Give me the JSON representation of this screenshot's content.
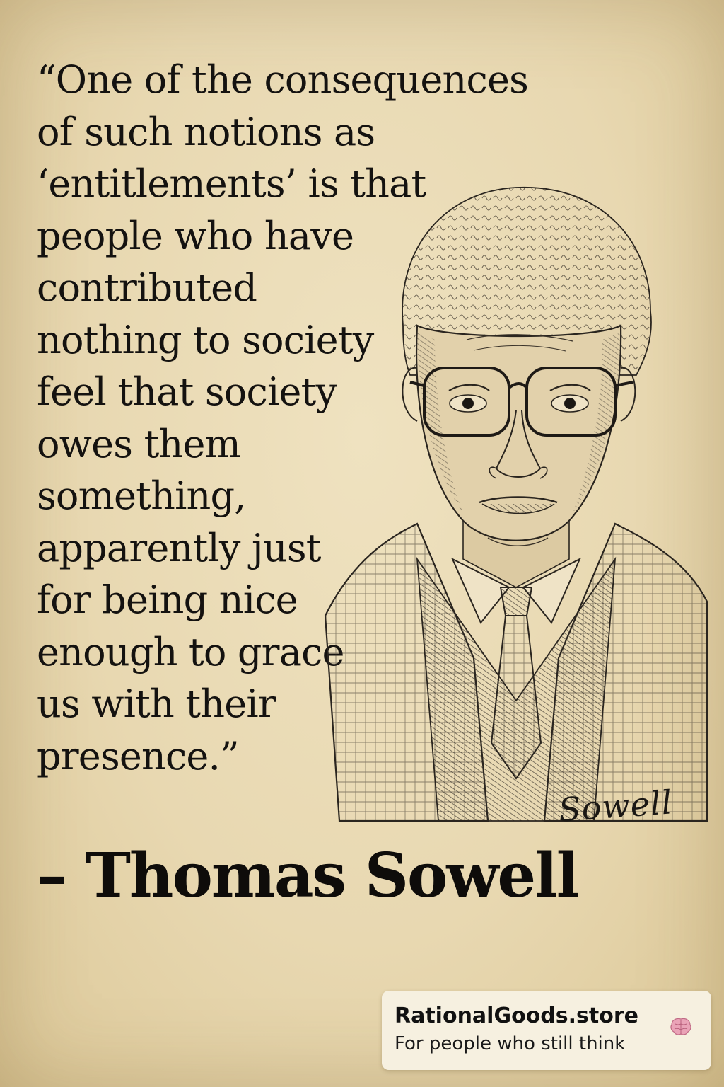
{
  "quote": {
    "lines": [
      "“One of the consequences",
      "of such notions as",
      "‘entitlements’ is that",
      "people who have",
      "contributed",
      "nothing to society",
      "feel that society",
      "owes them",
      "something,",
      "apparently just",
      "for being nice",
      "enough to grace",
      "us with their",
      "presence.”"
    ]
  },
  "attribution": "– Thomas Sowell",
  "portrait": {
    "subject": "pencil sketch portrait",
    "signature": "Sowell"
  },
  "brand": {
    "name": "RationalGoods.store",
    "tagline": "For people who still think",
    "icon": "brain-icon"
  },
  "colors": {
    "paper": "#e8d8b1",
    "ink": "#141210",
    "card": "#f6f0e0",
    "brain": "#e8a0b4"
  }
}
